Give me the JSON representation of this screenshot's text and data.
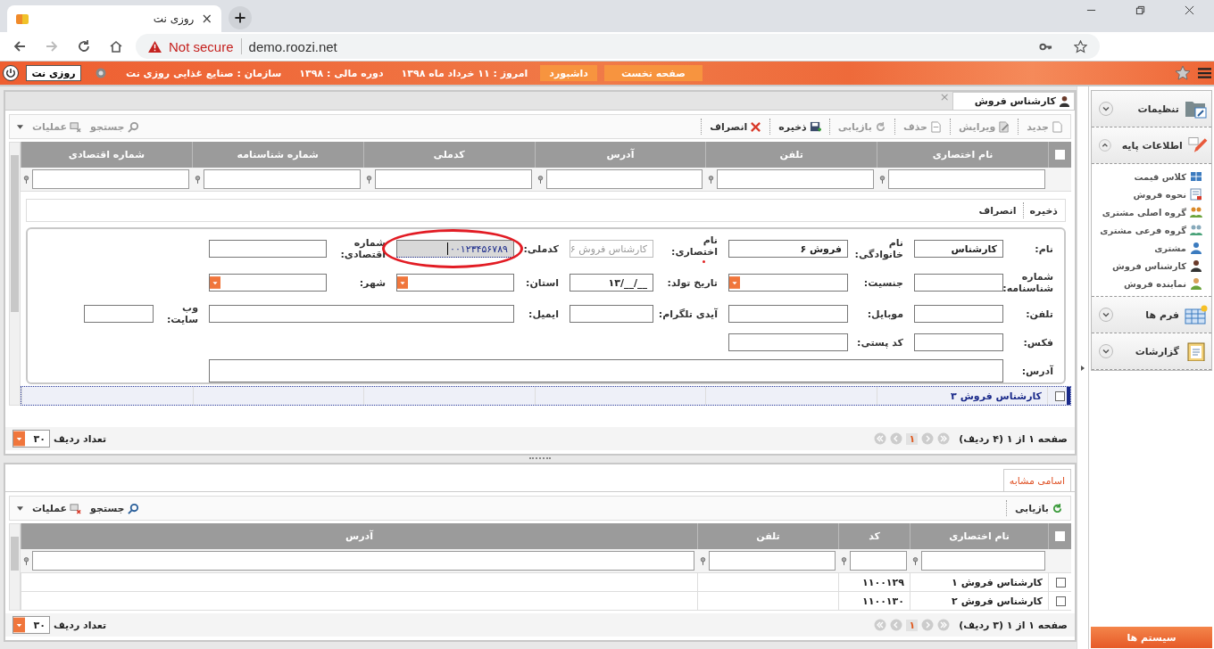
{
  "browser": {
    "tab_title": "روزی نت",
    "tab_close": "×",
    "security": "Not secure",
    "url": "demo.roozi.net"
  },
  "header": {
    "buttons": [
      "صفحه نخست",
      "داشبورد"
    ],
    "info": [
      "امروز :  ۱۱ خرداد ماه ۱۳۹۸",
      "دوره مالی :  ۱۳۹۸",
      "سازمان :  صنایع غذایی روزی نت"
    ],
    "user": "روزی نت"
  },
  "main": {
    "tab": {
      "title": "کارشناس فروش",
      "close": "×"
    },
    "toolbar": [
      {
        "label": "جدید",
        "kind": "new",
        "disabled": true
      },
      {
        "label": "ویرایش",
        "kind": "edit",
        "disabled": true
      },
      {
        "label": "حذف",
        "kind": "delete",
        "disabled": true
      },
      {
        "label": "بازیابی",
        "kind": "refresh",
        "disabled": true
      },
      {
        "label": "ذخیره",
        "kind": "save",
        "disabled": false
      },
      {
        "label": "انصراف",
        "kind": "cancel",
        "disabled": false
      }
    ],
    "toolbar_left": [
      {
        "label": "جستجو",
        "kind": "search",
        "disabled": true
      },
      {
        "label": "عملیات",
        "kind": "ops",
        "disabled": true
      }
    ],
    "all_checked": false,
    "columns": [
      "نام اختصاری",
      "تلفن",
      "آدرس",
      "کدملی",
      "شماره شناسنامه",
      "شماره اقتصادی"
    ],
    "form_toolbar": [
      "ذخیره",
      "انصراف"
    ],
    "form": [
      [
        {
          "label": "نام:",
          "value": "کارشناس",
          "kind": "text",
          "required": false,
          "circled": false
        },
        {
          "label": "نام خانوادگی:",
          "value": "فروش ۶",
          "kind": "text",
          "required": false,
          "circled": false
        },
        {
          "label": "نام اختصاری:",
          "value": "کارشناس فروش ۶",
          "kind": "readonly",
          "required": true,
          "circled": false
        },
        {
          "label": "کدملی:",
          "value": "۰۰۱۲۳۴۵۶۷۸۹",
          "kind": "text",
          "required": false,
          "circled": true
        },
        {
          "label": "شماره اقتصادی:",
          "kind": "text",
          "required": false,
          "circled": false
        }
      ],
      [
        {
          "label": "شماره شناسنامه:",
          "kind": "text",
          "required": false,
          "circled": false
        },
        {
          "label": "جنسیت:",
          "kind": "select",
          "required": false,
          "circled": false
        },
        {
          "label": "تاریخ تولد:",
          "value": "__/__/۱۳",
          "kind": "text",
          "required": false,
          "circled": false
        },
        {
          "label": "استان:",
          "kind": "select",
          "required": false,
          "circled": false
        },
        {
          "label": "شهر:",
          "kind": "select",
          "required": false,
          "circled": false
        }
      ],
      [
        {
          "label": "تلفن:",
          "kind": "text",
          "required": false,
          "circled": false
        },
        {
          "label": "موبایل:",
          "kind": "text",
          "required": false,
          "circled": false
        },
        {
          "label": "آیدی تلگرام:",
          "kind": "text",
          "required": false,
          "circled": false
        },
        {
          "label": "ایمیل:",
          "kind": "wide",
          "required": false,
          "circled": false
        },
        {
          "label": "وب سایت:",
          "kind": "small",
          "required": false,
          "circled": false
        }
      ],
      [
        {
          "label": "فکس:",
          "kind": "text",
          "required": false,
          "circled": false
        },
        {
          "label": "کد پستی:",
          "kind": "text",
          "required": false,
          "circled": false
        }
      ],
      [
        {
          "label": "آدرس:",
          "kind": "textarea",
          "required": false,
          "circled": false
        }
      ]
    ],
    "rows": [
      {
        "cells": [
          "کارشناس فروش ۳",
          "",
          "",
          "",
          "",
          ""
        ],
        "selected": true,
        "checked": false
      }
    ],
    "pager": {
      "text": "صفحه ۱ از ۱ (۴ ردیف)",
      "page": "۱",
      "page_size": "۳۰",
      "page_size_label": "تعداد ردیف"
    }
  },
  "similar": {
    "tab": "اسامی مشابه",
    "toolbar": [
      {
        "label": "بازیابی",
        "kind": "refresh",
        "disabled": false
      }
    ],
    "toolbar_left": [
      {
        "label": "جستجو",
        "kind": "search",
        "disabled": false
      },
      {
        "label": "عملیات",
        "kind": "ops",
        "disabled": false
      }
    ],
    "all_checked": false,
    "columns": [
      "نام اختصاری",
      "کد",
      "تلفن",
      "آدرس"
    ],
    "rows": [
      {
        "cells": [
          "کارشناس فروش ۱",
          "۱۱۰۰۱۲۹",
          "",
          ""
        ],
        "selected": false,
        "checked": false
      },
      {
        "cells": [
          "کارشناس فروش ۲",
          "۱۱۰۰۱۳۰",
          "",
          ""
        ],
        "selected": false,
        "checked": false
      }
    ],
    "pager": {
      "text": "صفحه ۱ از ۱ (۳ ردیف)",
      "page": "۱",
      "page_size": "۳۰",
      "page_size_label": "تعداد ردیف"
    }
  },
  "sidebar": {
    "sections": [
      {
        "title": "تنظیمات",
        "kind": "settings",
        "expanded": false
      },
      {
        "title": "اطلاعات پایه",
        "kind": "base",
        "expanded": true,
        "items": [
          {
            "label": "کلاس قیمت",
            "kind": "grid"
          },
          {
            "label": "نحوه فروش",
            "kind": "sale"
          },
          {
            "label": "گروه اصلی مشتری",
            "kind": "group"
          },
          {
            "label": "گروه فرعی مشتری",
            "kind": "subgroup"
          },
          {
            "label": "مشتری",
            "kind": "person"
          },
          {
            "label": "کارشناس فروش",
            "kind": "expert"
          },
          {
            "label": "نماینده فروش",
            "kind": "agent"
          }
        ]
      },
      {
        "title": "فرم ها",
        "kind": "forms",
        "expanded": false
      },
      {
        "title": "گزارشات",
        "kind": "reports",
        "expanded": false
      }
    ],
    "system_button": "سیستم ها"
  }
}
